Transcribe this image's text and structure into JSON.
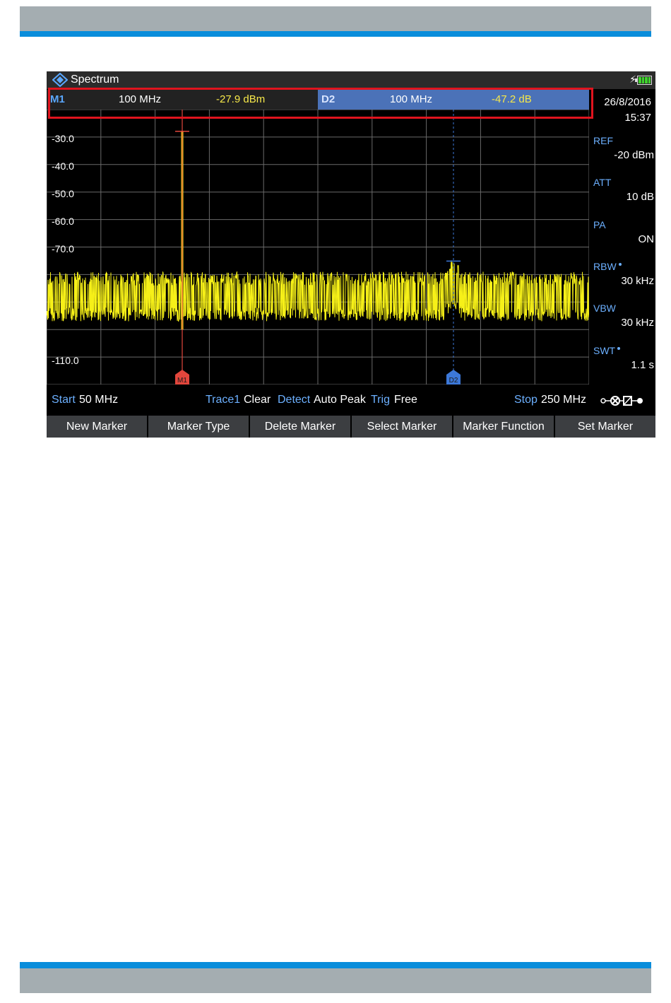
{
  "app": {
    "title": "Spectrum",
    "charging_symbol": "⚡",
    "icons": [
      "rohde-schwarz-logo-icon",
      "charging-icon",
      "battery-icon",
      "connection-icon"
    ]
  },
  "markers": {
    "m1": {
      "name": "M1",
      "freq": "100 MHz",
      "level": "-27.9 dBm"
    },
    "d2": {
      "name": "D2",
      "freq": "100 MHz",
      "level": "-47.2 dB"
    }
  },
  "side": {
    "date": "26/8/2016",
    "time": "15:37",
    "ref_label": "REF",
    "ref_value": "-20 dBm",
    "att_label": "ATT",
    "att_value": "10 dB",
    "pa_label": "PA",
    "pa_value": "ON",
    "rbw_label": "RBW",
    "rbw_value": "30 kHz",
    "vbw_label": "VBW",
    "vbw_value": "30 kHz",
    "swt_label": "SWT",
    "swt_value": "1.1 s"
  },
  "plot": {
    "y_ticks": [
      "-30.0",
      "-40.0",
      "-50.0",
      "-60.0",
      "-70.0",
      "-110.0"
    ],
    "m1_tag": "M1",
    "d2_tag": "D2"
  },
  "status": {
    "start_label": "Start",
    "start_value": "50 MHz",
    "trace_label": "Trace1",
    "trace_value": "Clear",
    "detect_label": "Detect",
    "detect_value": "Auto Peak",
    "trig_label": "Trig",
    "trig_value": "Free",
    "stop_label": "Stop",
    "stop_value": "250 MHz"
  },
  "softkeys": [
    "New Marker",
    "Marker Type",
    "Delete Marker",
    "Select Marker",
    "Marker Function",
    "Set Marker"
  ],
  "colors": {
    "trace": "#f6f018",
    "m1_marker": "#e2463c",
    "d2_marker": "#3c78d8",
    "accent_blue": "#0a8ddb",
    "highlight": "#e0141e"
  },
  "chart_data": {
    "type": "line",
    "x_unit": "MHz",
    "y_unit": "dBm",
    "xlim": [
      50,
      250
    ],
    "ylim": [
      -120,
      -20
    ],
    "grid": true,
    "noise_floor_range": [
      -97,
      -79
    ],
    "peaks": [
      {
        "marker": "M1",
        "x": 100,
        "y": -27.9
      },
      {
        "marker": "D2",
        "x": 200,
        "y": -75.1
      }
    ]
  }
}
